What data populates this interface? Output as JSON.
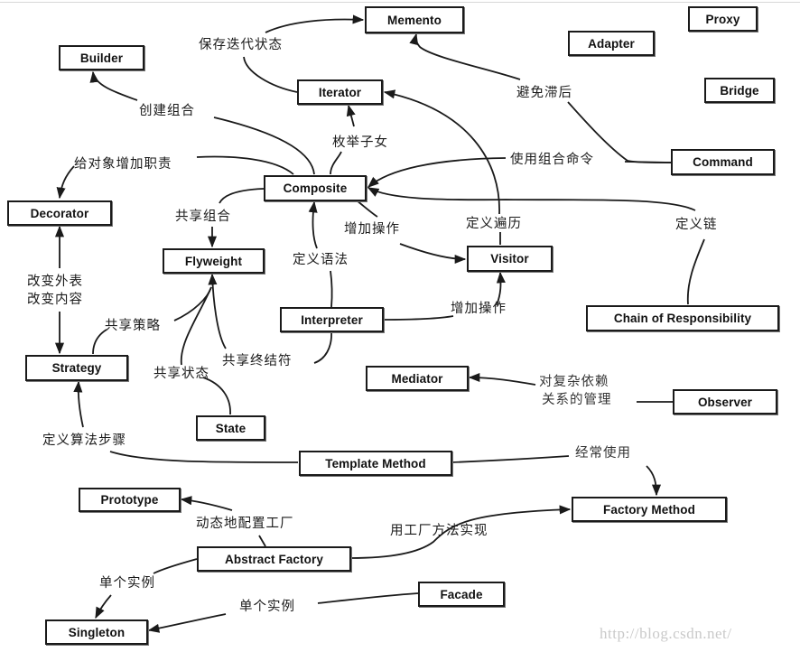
{
  "diagram": {
    "type": "design-pattern-relationship-map",
    "nodes": {
      "memento": "Memento",
      "proxy": "Proxy",
      "adapter": "Adapter",
      "builder": "Builder",
      "iterator": "Iterator",
      "bridge": "Bridge",
      "command": "Command",
      "composite": "Composite",
      "decorator": "Decorator",
      "flyweight": "Flyweight",
      "visitor": "Visitor",
      "chain": "Chain of Responsibility",
      "interpreter": "Interpreter",
      "strategy": "Strategy",
      "mediator": "Mediator",
      "observer": "Observer",
      "state": "State",
      "template": "Template Method",
      "prototype": "Prototype",
      "factory_method": "Factory Method",
      "abstract_factory": "Abstract Factory",
      "facade": "Facade",
      "singleton": "Singleton"
    },
    "edge_labels": {
      "iterator_memento": "保存迭代状态",
      "command_memento": "避免滞后",
      "composite_builder": "创建组合",
      "composite_iterator": "枚举子女",
      "composite_decorator": "给对象增加职责",
      "command_composite": "使用组合命令",
      "composite_flyweight": "共享组合",
      "composite_visitor": "增加操作",
      "visitor_iterator": "定义遍历",
      "chain_composite": "定义链",
      "interpreter_composite": "定义语法",
      "decorator_strategy_line1": "改变外表",
      "decorator_strategy_line2": "改变内容",
      "strategy_flyweight": "共享策略",
      "interpreter_visitor": "增加操作",
      "interpreter_flyweight": "共享终结符",
      "state_flyweight": "共享状态",
      "observer_mediator_line1": "对复杂依赖",
      "observer_mediator_line2": "关系的管理",
      "template_strategy": "定义算法步骤",
      "template_factory_method": "经常使用",
      "abstract_factory_prototype": "动态地配置工厂",
      "abstract_factory_factory_method": "用工厂方法实现",
      "abstract_factory_singleton": "单个实例",
      "facade_singleton": "单个实例"
    },
    "edges": [
      {
        "from": "Iterator",
        "to": "Memento",
        "label": "保存迭代状态"
      },
      {
        "from": "Command",
        "to": "Memento",
        "label": "避免滞后"
      },
      {
        "from": "Composite",
        "to": "Builder",
        "label": "创建组合"
      },
      {
        "from": "Composite",
        "to": "Iterator",
        "label": "枚举子女"
      },
      {
        "from": "Composite",
        "to": "Decorator",
        "label": "给对象增加职责"
      },
      {
        "from": "Command",
        "to": "Composite",
        "label": "使用组合命令"
      },
      {
        "from": "Composite",
        "to": "Flyweight",
        "label": "共享组合"
      },
      {
        "from": "Composite",
        "to": "Visitor",
        "label": "增加操作"
      },
      {
        "from": "Visitor",
        "to": "Iterator",
        "label": "定义遍历"
      },
      {
        "from": "Chain of Responsibility",
        "to": "Composite",
        "label": "定义链"
      },
      {
        "from": "Interpreter",
        "to": "Composite",
        "label": "定义语法"
      },
      {
        "from": "Strategy",
        "to": "Decorator",
        "label": "改变外表 / 改变内容",
        "bidirectional": true
      },
      {
        "from": "Strategy",
        "to": "Flyweight",
        "label": "共享策略"
      },
      {
        "from": "Interpreter",
        "to": "Visitor",
        "label": "增加操作"
      },
      {
        "from": "Interpreter",
        "to": "Flyweight",
        "label": "共享终结符"
      },
      {
        "from": "State",
        "to": "Flyweight",
        "label": "共享状态"
      },
      {
        "from": "Observer",
        "to": "Mediator",
        "label": "对复杂依赖关系的管理"
      },
      {
        "from": "Template Method",
        "to": "Strategy",
        "label": "定义算法步骤"
      },
      {
        "from": "Template Method",
        "to": "Factory Method",
        "label": "经常使用"
      },
      {
        "from": "Abstract Factory",
        "to": "Prototype",
        "label": "动态地配置工厂"
      },
      {
        "from": "Abstract Factory",
        "to": "Factory Method",
        "label": "用工厂方法实现"
      },
      {
        "from": "Abstract Factory",
        "to": "Singleton",
        "label": "单个实例"
      },
      {
        "from": "Facade",
        "to": "Singleton",
        "label": "单个实例"
      }
    ]
  },
  "watermark": "http://blog.csdn.net/"
}
